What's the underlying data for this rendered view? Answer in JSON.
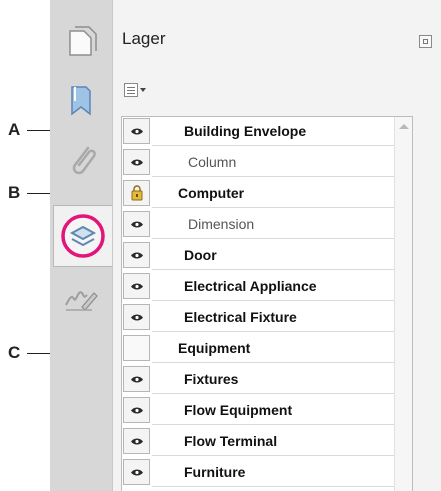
{
  "callouts": [
    {
      "letter": "A",
      "target": "Building Envelope"
    },
    {
      "letter": "B",
      "target": "Computer"
    },
    {
      "letter": "C",
      "target": "Equipment"
    }
  ],
  "nav": {
    "buttons": [
      "pages-icon",
      "bookmarks-icon",
      "attachments-icon",
      "layers-icon",
      "signatures-icon"
    ],
    "active": "layers-icon",
    "highlight_color": "#e2157a"
  },
  "panel": {
    "title": "Lager"
  },
  "layers": [
    {
      "name": "Building Envelope",
      "visibility": "eye",
      "style": "bold"
    },
    {
      "name": "Column",
      "visibility": "eye",
      "style": "muted"
    },
    {
      "name": "Computer",
      "visibility": "lock",
      "style": "bold"
    },
    {
      "name": "Dimension",
      "visibility": "eye",
      "style": "muted"
    },
    {
      "name": "Door",
      "visibility": "eye",
      "style": "bold"
    },
    {
      "name": "Electrical Appliance",
      "visibility": "eye",
      "style": "bold"
    },
    {
      "name": "Electrical Fixture",
      "visibility": "eye",
      "style": "bold"
    },
    {
      "name": "Equipment",
      "visibility": "hidden",
      "style": "bold"
    },
    {
      "name": "Fixtures",
      "visibility": "eye",
      "style": "bold"
    },
    {
      "name": "Flow Equipment",
      "visibility": "eye",
      "style": "bold"
    },
    {
      "name": "Flow Terminal",
      "visibility": "eye",
      "style": "bold"
    },
    {
      "name": "Furniture",
      "visibility": "eye",
      "style": "bold"
    }
  ]
}
